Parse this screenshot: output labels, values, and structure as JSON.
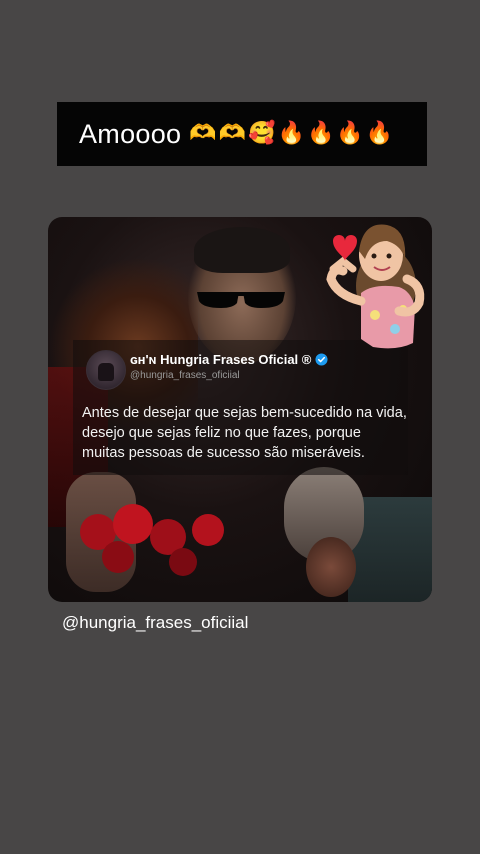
{
  "story": {
    "caption": {
      "text": "Amoooo",
      "emojis": [
        "🫶",
        "🫶",
        "🥰",
        "🔥",
        "🔥",
        "🔥",
        "🔥"
      ]
    },
    "tweet": {
      "display_name": "ɢʜ'ɴ Hungria Frases Oficial ®",
      "handle": "@hungria_frases_oficiial",
      "body": "Antes de desejar que sejas bem-sucedido na vida, desejo que sejas feliz no que fazes, porque muitas pessoas de sucesso são miseráveis.",
      "verified_color": "#1d9bf0"
    },
    "mention": "@hungria_frases_oficiial"
  },
  "colors": {
    "background": "#484646",
    "caption_bar": "#050505",
    "heart": "#e8283c"
  }
}
